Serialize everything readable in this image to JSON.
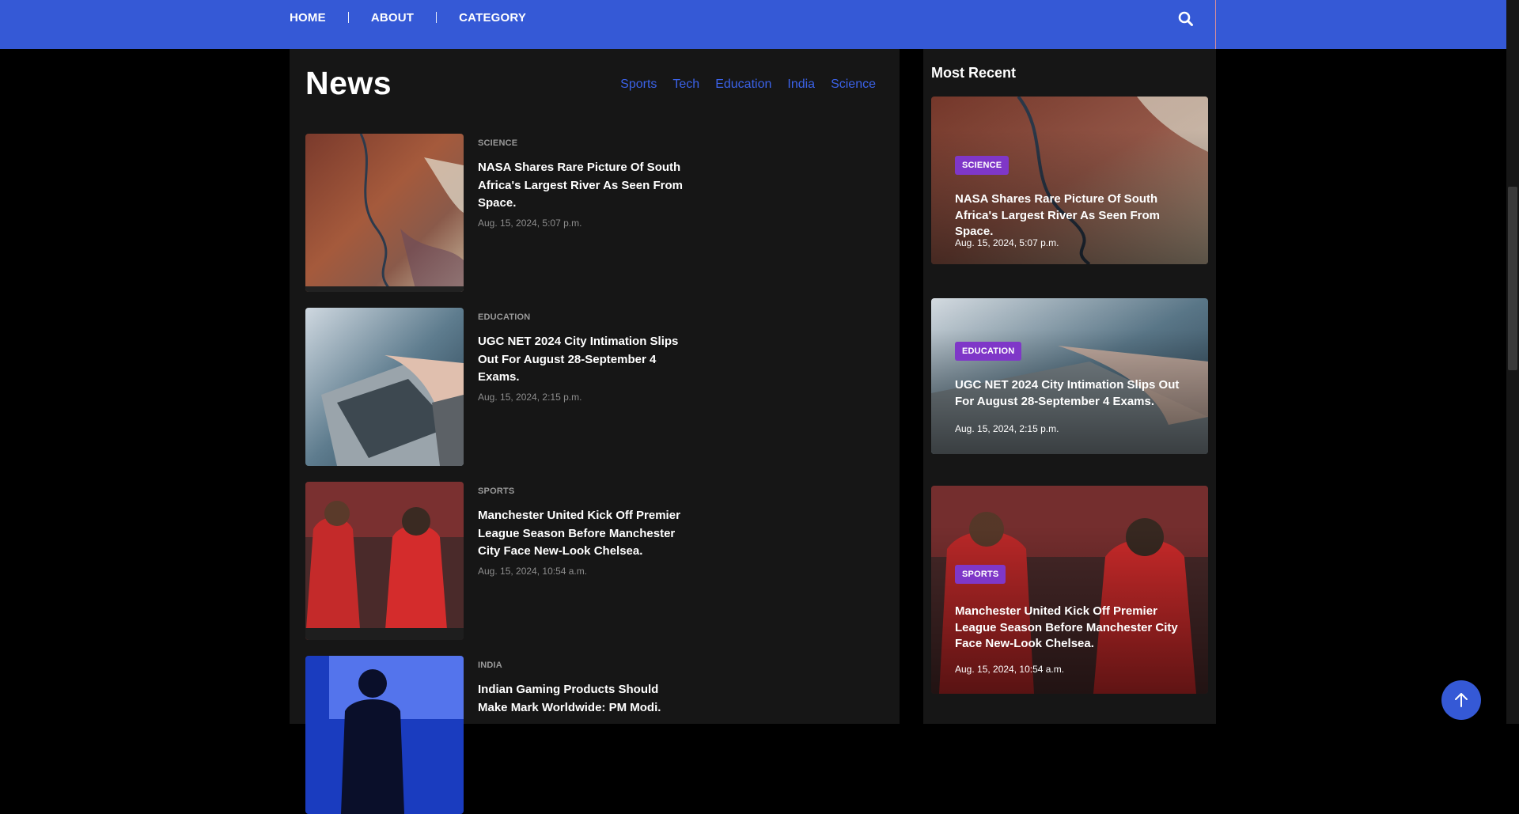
{
  "nav": {
    "items": [
      "HOME",
      "ABOUT",
      "CATEGORY"
    ]
  },
  "main": {
    "title": "News",
    "categories": [
      "Sports",
      "Tech",
      "Education",
      "India",
      "Science"
    ],
    "items": [
      {
        "category": "SCIENCE",
        "title": "NASA Shares Rare Picture Of South Africa's Largest River As Seen From Space.",
        "date": "Aug. 15, 2024, 5:07 p.m."
      },
      {
        "category": "EDUCATION",
        "title": "UGC NET 2024 City Intimation Slips Out For August 28-September 4 Exams.",
        "date": "Aug. 15, 2024, 2:15 p.m."
      },
      {
        "category": "SPORTS",
        "title": "Manchester United Kick Off Premier League Season Before Manchester City Face New-Look Chelsea.",
        "date": "Aug. 15, 2024, 10:54 a.m."
      },
      {
        "category": "INDIA",
        "title": "Indian Gaming Products Should Make Mark Worldwide: PM Modi.",
        "date": ""
      }
    ]
  },
  "sidebar": {
    "heading": "Most Recent",
    "cards": [
      {
        "badge": "SCIENCE",
        "title": "NASA Shares Rare Picture Of South Africa's Largest River As Seen From Space.",
        "date": "Aug. 15, 2024, 5:07 p.m."
      },
      {
        "badge": "EDUCATION",
        "title": "UGC NET 2024 City Intimation Slips Out For August 28-September 4 Exams.",
        "date": "Aug. 15, 2024, 2:15 p.m."
      },
      {
        "badge": "SPORTS",
        "title": "Manchester United Kick Off Premier League Season Before Manchester City Face New-Look Chelsea.",
        "date": "Aug. 15, 2024, 10:54 a.m."
      }
    ]
  },
  "colors": {
    "nav": "#3559d6",
    "accent_link": "#3b62e8",
    "badge": "#7f37c8",
    "panel": "#161616",
    "page": "#000000"
  },
  "icons": {
    "search": "search-icon",
    "back_to_top": "arrow-up-icon"
  }
}
